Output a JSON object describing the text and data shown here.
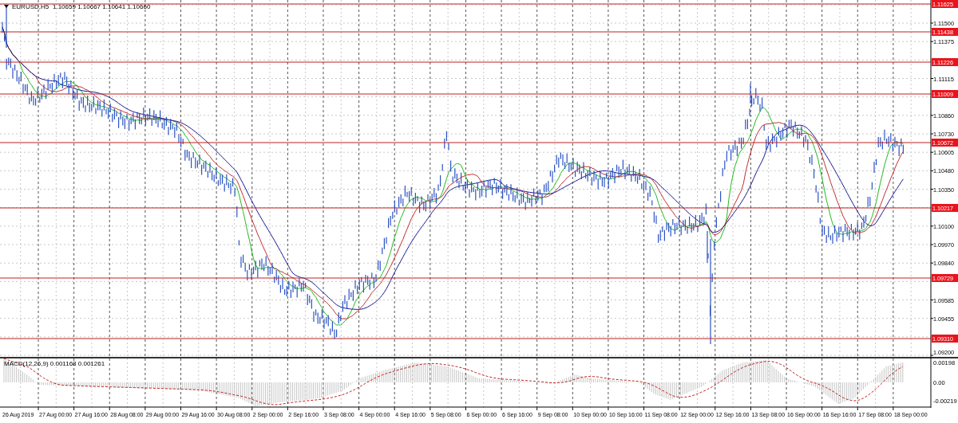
{
  "window": {
    "symbol": "EURUSD,H5",
    "quote": "1.10659 1.10667 1.10641 1.10660"
  },
  "price_axis": {
    "ticks": [
      "1.11500",
      "1.11375",
      "1.11115",
      "1.10860",
      "1.10730",
      "1.10605",
      "1.10480",
      "1.10350",
      "1.10100",
      "1.09970",
      "1.09840",
      "1.09585",
      "1.09455",
      "1.09200"
    ]
  },
  "levels": [
    {
      "label": "1.11625"
    },
    {
      "label": "1.11438"
    },
    {
      "label": "1.11226"
    },
    {
      "label": "1.11009"
    },
    {
      "label": "1.10672"
    },
    {
      "label": "1.10217"
    },
    {
      "label": "1.09729"
    },
    {
      "label": "1.09310"
    }
  ],
  "macd": {
    "title": "MACD(12,26,9) 0.001168 0.001261",
    "ticks": [
      "0.00198",
      "0.00",
      "-0.00219"
    ]
  },
  "time_axis": {
    "labels": [
      "26 Aug 2019",
      "27 Aug 00:00",
      "27 Aug 16:00",
      "28 Aug 08:00",
      "29 Aug 00:00",
      "29 Aug 16:00",
      "30 Aug 08:00",
      "2 Sep 00:00",
      "2 Sep 16:00",
      "3 Sep 08:00",
      "4 Sep 00:00",
      "4 Sep 16:00",
      "5 Sep 08:00",
      "6 Sep 00:00",
      "6 Sep 16:00",
      "9 Sep 08:00",
      "10 Sep 00:00",
      "10 Sep 16:00",
      "11 Sep 08:00",
      "12 Sep 00:00",
      "12 Sep 16:00",
      "13 Sep 08:00",
      "16 Sep 00:00",
      "16 Sep 16:00",
      "17 Sep 08:00",
      "18 Sep 00:00"
    ]
  }
}
